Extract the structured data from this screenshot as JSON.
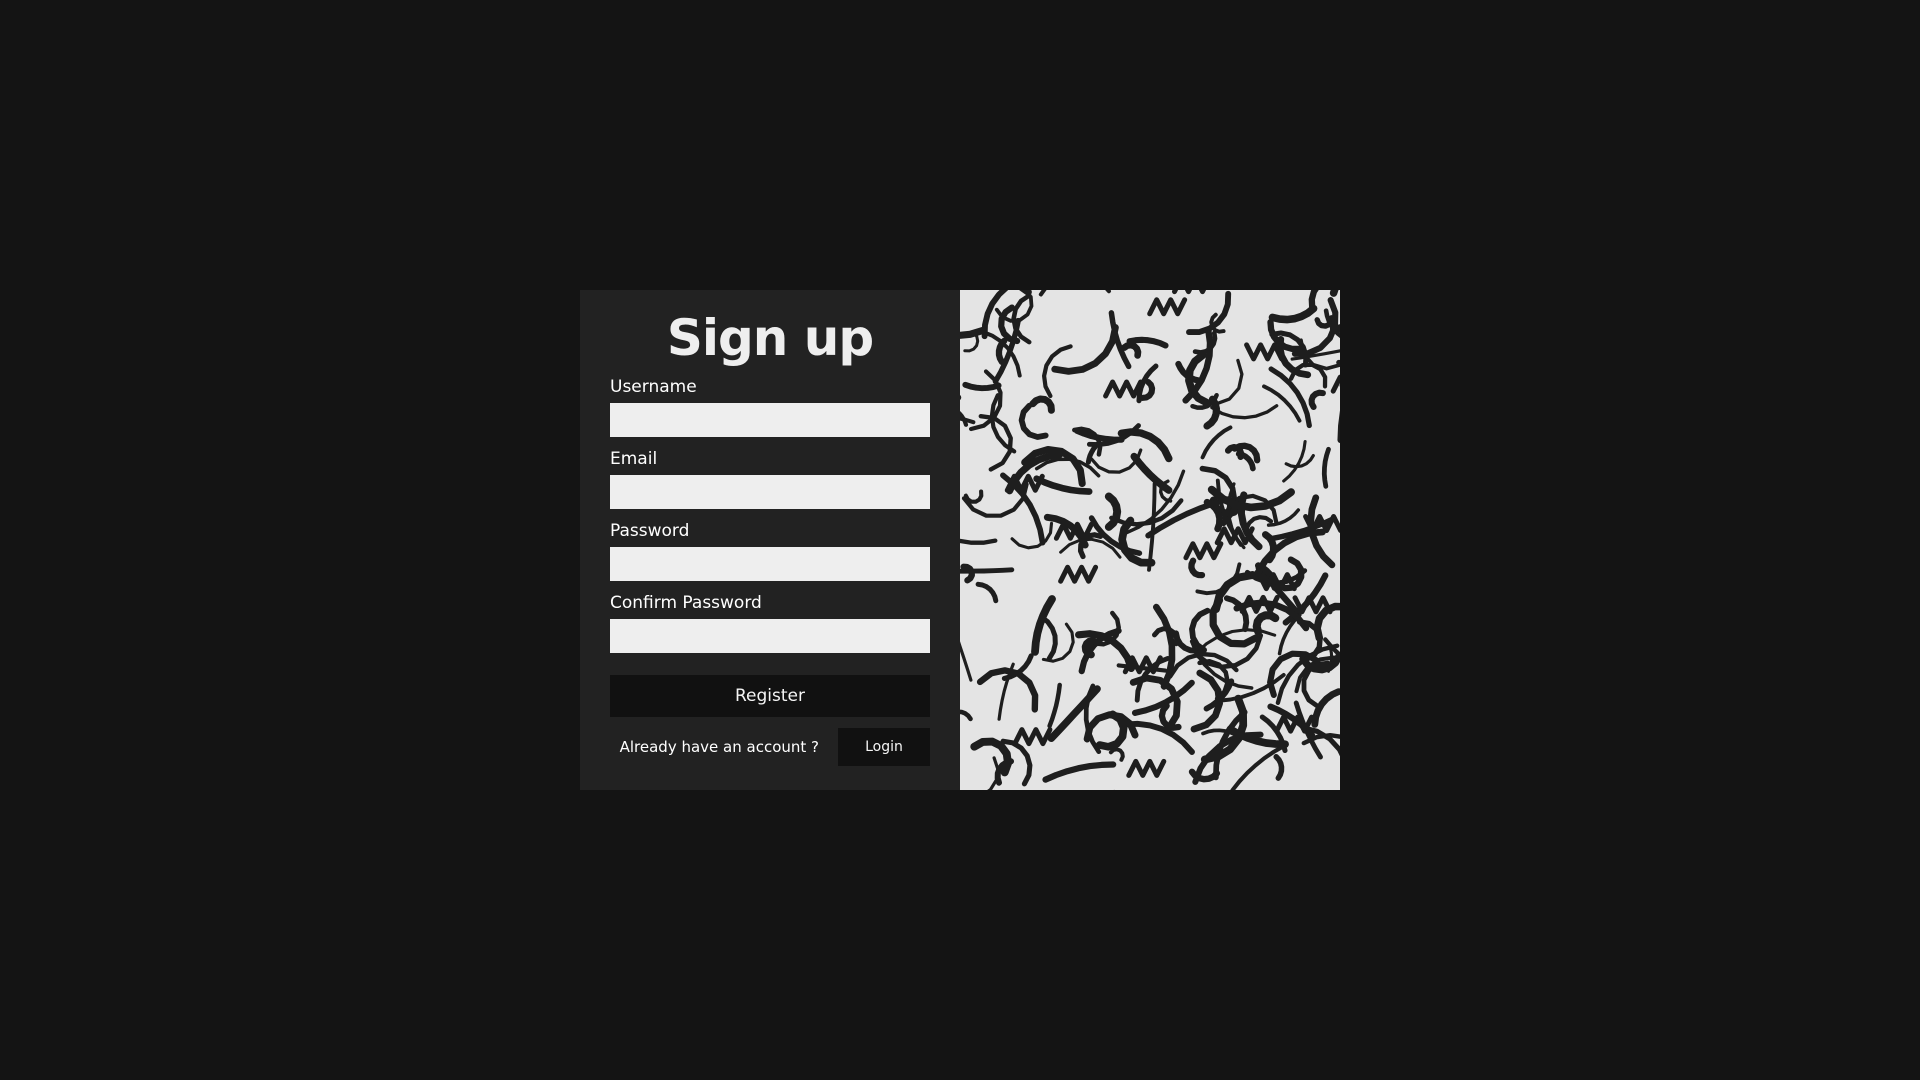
{
  "signup": {
    "title": "Sign up",
    "fields": [
      {
        "label": "Username",
        "value": "",
        "placeholder": ""
      },
      {
        "label": "Email",
        "value": "",
        "placeholder": ""
      },
      {
        "label": "Password",
        "value": "",
        "placeholder": ""
      },
      {
        "label": "Confirm Password",
        "value": "",
        "placeholder": ""
      }
    ],
    "register_label": "Register",
    "login_prompt": "Already have an account ?",
    "login_label": "Login"
  },
  "colors": {
    "background": "#141414",
    "panel": "#222222",
    "input": "#eeeeee",
    "button": "#111111",
    "pattern_light": "#e4e4e4",
    "pattern_dark": "#1e1e1e"
  }
}
